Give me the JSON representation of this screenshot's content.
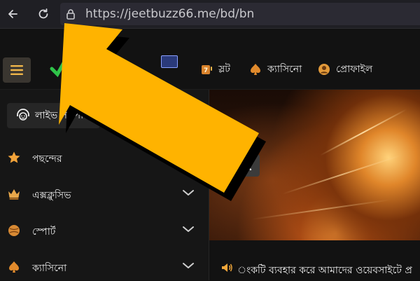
{
  "browser": {
    "url": "https://jeetbuzz66.me/bd/bn",
    "back_icon": "arrow-left-icon",
    "reload_icon": "reload-icon",
    "lock_icon": "lock-icon"
  },
  "header": {
    "menu_icon": "hamburger-icon",
    "logo_icon": "jeetbuzz-logo",
    "nav": [
      {
        "label": "স্লট",
        "icon": "slot-machine-icon"
      },
      {
        "label": "ক্যাসিনো",
        "icon": "spade-chip-icon"
      },
      {
        "label": "প্রোফাইল",
        "icon": "profile-icon"
      }
    ]
  },
  "sidebar": {
    "support_label": "লাইভ সাপোর্ট",
    "items": [
      {
        "label": "পছন্দের",
        "icon": "star-icon",
        "expandable": false
      },
      {
        "label": "এক্সক্লুসিভ",
        "icon": "crown-icon",
        "expandable": true
      },
      {
        "label": "স্পোর্ট",
        "icon": "ball-icon",
        "expandable": true
      },
      {
        "label": "ক্যাসিনো",
        "icon": "spade-chip-icon",
        "expandable": true
      }
    ]
  },
  "main": {
    "ticker_text": "ংকটি ব্যবহার করে আমাদের ওয়েবসাইটে প্র",
    "speaker_icon": "speaker-icon",
    "prev_icon": "chevron-left-icon"
  },
  "overlay": {
    "arrow_color": "#ffb300",
    "shadow_color": "#000000"
  },
  "colors": {
    "accent": "#ffb300",
    "page_bg": "#121212",
    "sidebar_bg": "#161616"
  }
}
